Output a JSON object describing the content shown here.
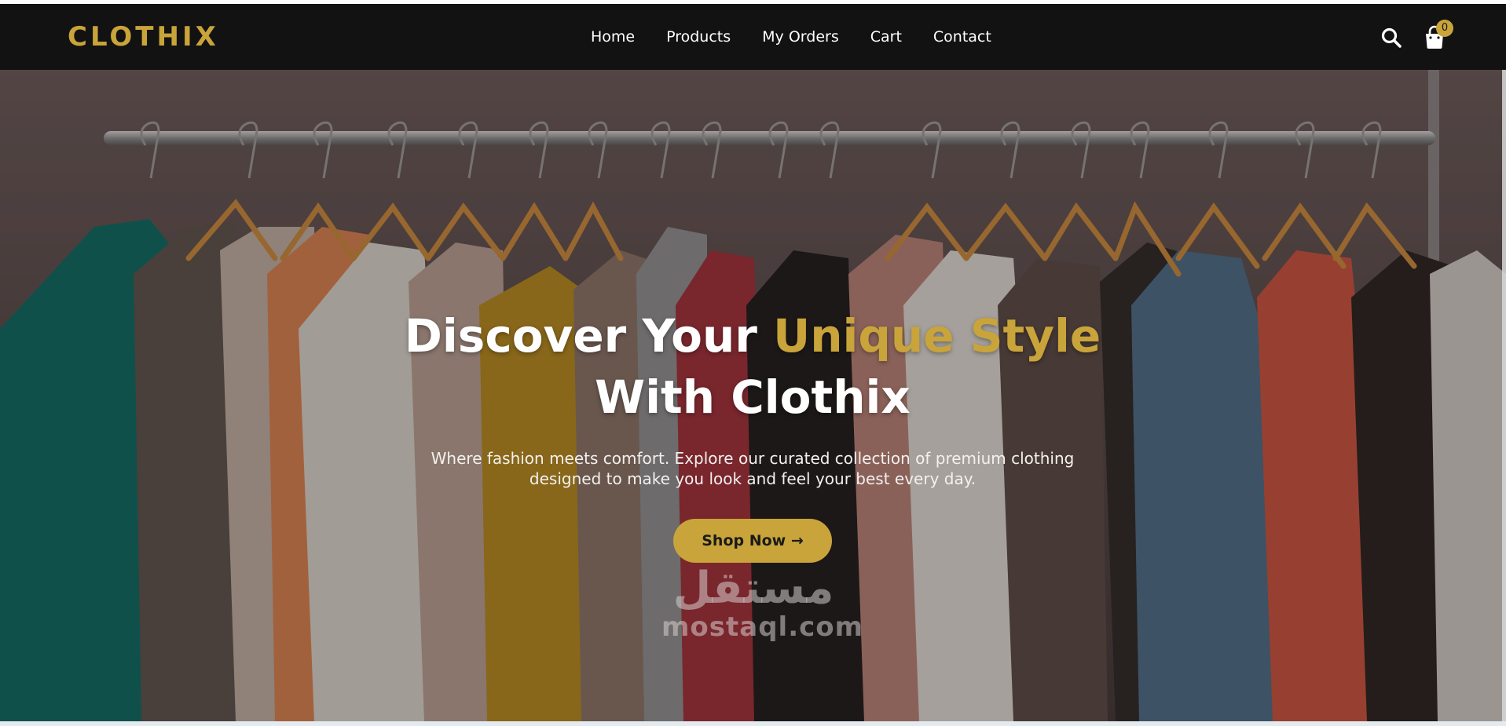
{
  "header": {
    "logo": "CLOTHIX",
    "nav": [
      "Home",
      "Products",
      "My Orders",
      "Cart",
      "Contact"
    ],
    "search_icon": "search-icon",
    "cart_icon": "shopping-bag-icon",
    "cart_count": "0"
  },
  "hero": {
    "title_part1": "Discover Your ",
    "title_accent": "Unique Style",
    "title_part2": "With Clothix",
    "subtitle": "Where fashion meets comfort. Explore our curated collection of premium clothing designed to make you look and feel your best every day.",
    "cta": "Shop Now →",
    "background": "clothing-rack-photo"
  },
  "watermark": {
    "arabic": "مستقل",
    "latin": "mostaql.com"
  },
  "colors": {
    "accent": "#c9a43a",
    "header_bg": "#121212",
    "text_light": "#ffffff"
  }
}
